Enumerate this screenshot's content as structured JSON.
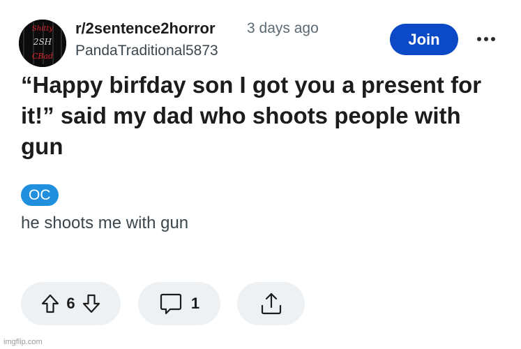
{
  "post": {
    "subreddit": "r/2sentence2horror",
    "time": "3 days ago",
    "username": "PandaTraditional5873",
    "join_label": "Join",
    "title": "“Happy birfday son I got you a present for it!” said my dad who shoots people with gun",
    "flair": "OC",
    "body": "he shoots me with gun",
    "votes": "6",
    "comments": "1"
  },
  "avatar_text": [
    "Shitty",
    "2SH",
    "CBad"
  ],
  "icons": {
    "more": "more-options-icon",
    "upvote": "upvote-arrow-icon",
    "downvote": "downvote-arrow-icon",
    "comment": "comment-bubble-icon",
    "share": "share-upload-icon"
  },
  "colors": {
    "join_button": "#0b49c6",
    "flair": "#1f8fde",
    "action_pill": "#eef1f3"
  },
  "watermark": "imgflip.com"
}
